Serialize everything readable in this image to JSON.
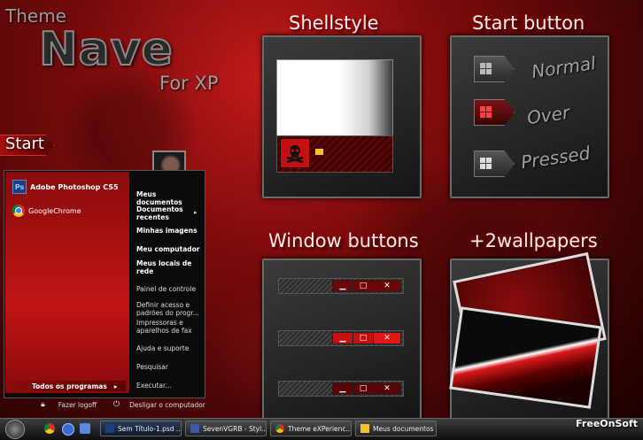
{
  "header": {
    "theme": "Theme",
    "name": "Nave",
    "for": "For XP"
  },
  "sections": {
    "shellstyle": "Shellstyle",
    "start_button": "Start button",
    "window_buttons": "Window buttons",
    "wallpapers": "+2wallpapers"
  },
  "start_states": [
    "Normal",
    "Over",
    "Pressed"
  ],
  "start_menu": {
    "start_label": "Start",
    "pinned": [
      {
        "label": "Adobe Photoshop CS5",
        "icon": "photoshop-icon"
      },
      {
        "label": "GoogleChrome",
        "icon": "chrome-icon"
      }
    ],
    "right_items": [
      "Meus documentos",
      "Documentos recentes",
      "Minhas imagens",
      "Meu computador",
      "Meus locais de rede",
      "Painel de controle",
      "Definir acesso e padrões do progr...",
      "Impressoras e aparelhos de fax",
      "Ajuda e suporte",
      "Pesquisar",
      "Executar..."
    ],
    "all_programs": "Todos os programas",
    "logoff": "Fazer logoff",
    "shutdown": "Desligar o computador"
  },
  "taskbar": {
    "items": [
      {
        "label": "Sem Título-1.psd ...",
        "icon": "photoshop-icon",
        "active": true
      },
      {
        "label": "SevenVGRB - Styl...",
        "icon": "window-icon",
        "active": false
      },
      {
        "label": "Theme eXPerienc...",
        "icon": "chrome-icon",
        "active": false
      },
      {
        "label": "Meus documentos",
        "icon": "folder-icon",
        "active": false
      }
    ]
  },
  "watermark": "FreeOnSoft",
  "colors": {
    "accent": "#c41010",
    "background": "#5a0606",
    "panel": "#2a2a2a"
  }
}
